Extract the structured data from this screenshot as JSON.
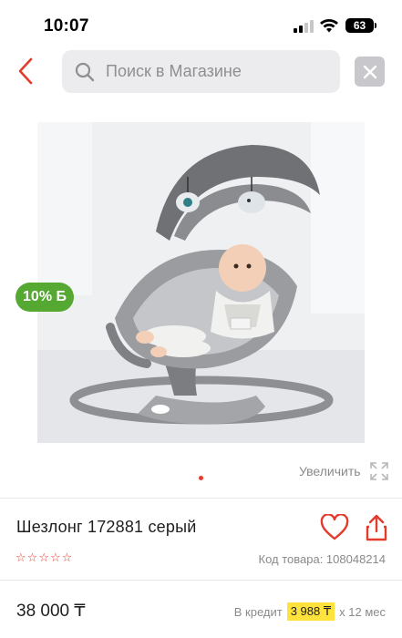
{
  "status": {
    "time": "10:07",
    "battery": "63"
  },
  "search": {
    "placeholder": "Поиск в Магазине"
  },
  "colors": {
    "accent": "#e33b2c",
    "cashback": "#55a832",
    "credit_highlight": "#ffe23b"
  },
  "gallery": {
    "cashback_badge": "10% Б",
    "zoom_label": "Увеличить",
    "page_count": 1,
    "active_page": 1
  },
  "product": {
    "title": "Шезлонг 172881 серый",
    "rating_stars": 5,
    "rating_value": 0,
    "sku": "Код товара: 108048214",
    "price": "38 000 ₸",
    "credit_prefix": "В кредит",
    "credit_amount": "3 988 ₸",
    "credit_term": "x 12 мес"
  },
  "icons": {
    "back": "chevron-left-icon",
    "search": "search-icon",
    "clear": "close-icon",
    "zoom": "expand-icon",
    "favorite": "heart-icon",
    "share": "share-icon",
    "star": "star-outline-icon"
  }
}
